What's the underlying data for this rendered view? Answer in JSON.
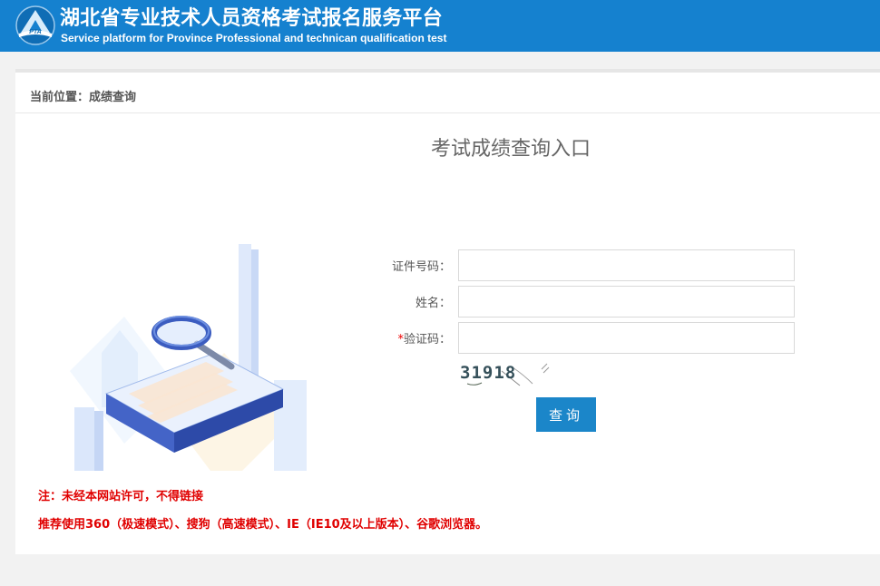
{
  "header": {
    "title_cn": "湖北省专业技术人员资格考试报名服务平台",
    "title_en": "Service platform for Province Professional and technican qualification test",
    "logo_text": "PTA"
  },
  "breadcrumb": {
    "text": "当前位置：成绩查询"
  },
  "form": {
    "title": "考试成绩查询入口",
    "id_label": "证件号码：",
    "id_value": "",
    "name_label": "姓名：",
    "name_value": "",
    "captcha_required": "*",
    "captcha_label": "验证码：",
    "captcha_value": "",
    "captcha_image_text": "31918",
    "submit_label": "查询"
  },
  "notes": {
    "line1": "注：未经本网站许可，不得链接",
    "line2": "推荐使用360（极速模式）、搜狗（高速模式）、IE（IE10及以上版本）、谷歌浏览器。"
  },
  "colors": {
    "header_bg": "#1581cf",
    "button_bg": "#1b86c9",
    "warning_text": "#e00000"
  }
}
